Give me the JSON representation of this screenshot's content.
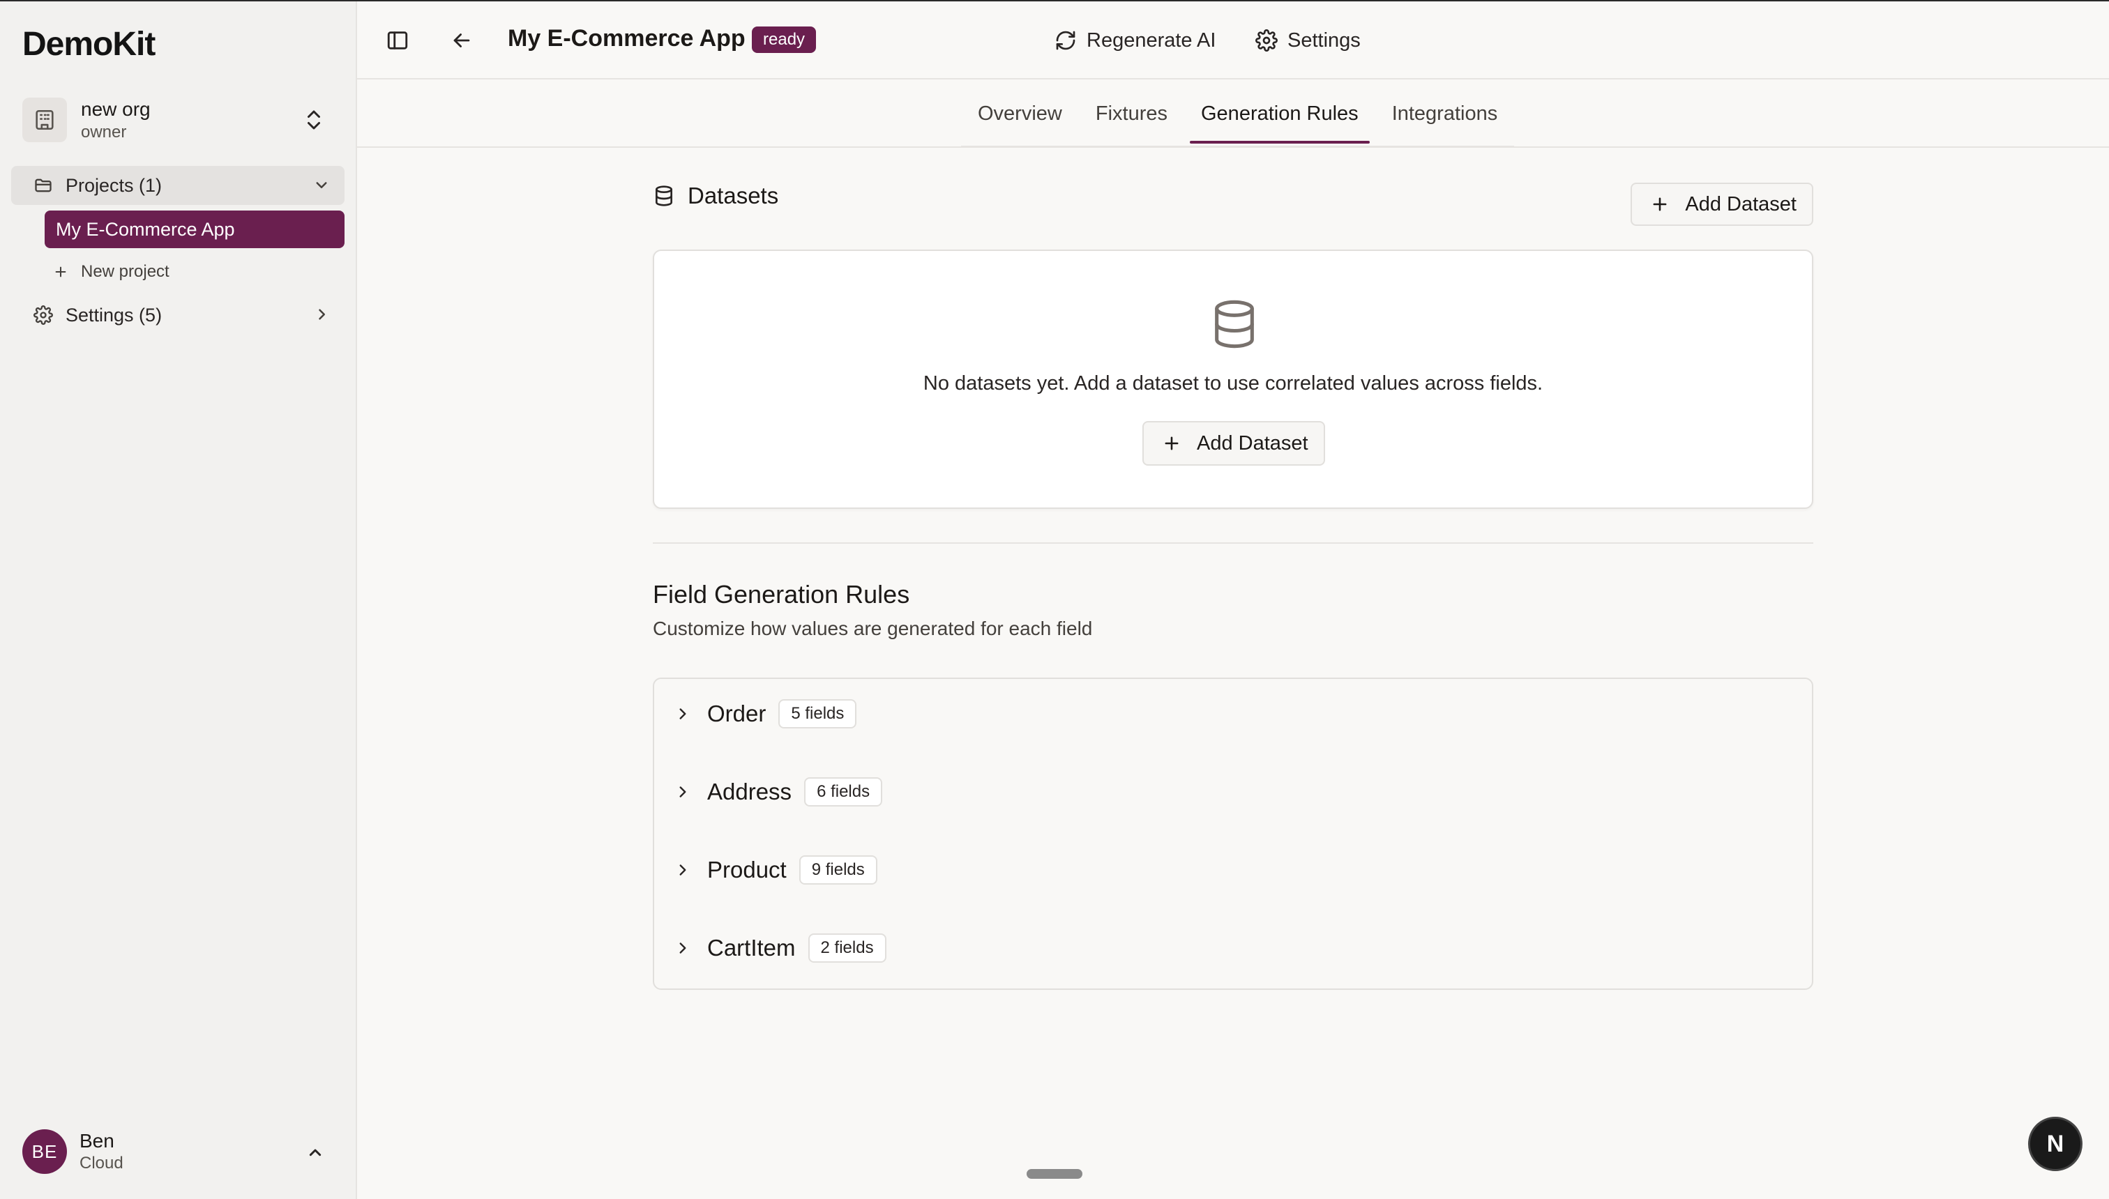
{
  "brand": "DemoKit",
  "org": {
    "name": "new org",
    "role": "owner"
  },
  "sidebar": {
    "projects_label": "Projects (1)",
    "active_project": "My E-Commerce App",
    "new_project": "New project",
    "settings_label": "Settings (5)"
  },
  "user": {
    "initials": "BE",
    "name": "Ben",
    "plan": "Cloud"
  },
  "header": {
    "title": "My E-Commerce App",
    "status": "ready",
    "regenerate": "Regenerate AI",
    "settings": "Settings"
  },
  "tabs": [
    {
      "label": "Overview"
    },
    {
      "label": "Fixtures"
    },
    {
      "label": "Generation Rules"
    },
    {
      "label": "Integrations"
    }
  ],
  "datasets": {
    "title": "Datasets",
    "add_button": "Add Dataset",
    "empty_text": "No datasets yet. Add a dataset to use correlated values across fields.",
    "empty_button": "Add Dataset"
  },
  "rules": {
    "title": "Field Generation Rules",
    "subtitle": "Customize how values are generated for each field",
    "items": [
      {
        "name": "Order",
        "fields": "5 fields"
      },
      {
        "name": "Address",
        "fields": "6 fields"
      },
      {
        "name": "Product",
        "fields": "9 fields"
      },
      {
        "name": "CartItem",
        "fields": "2 fields"
      }
    ]
  },
  "floating_badge": "N",
  "colors": {
    "accent": "#6a1f4f",
    "sidebar_bg": "#f2f1ef",
    "page_bg": "#f9f8f6"
  }
}
